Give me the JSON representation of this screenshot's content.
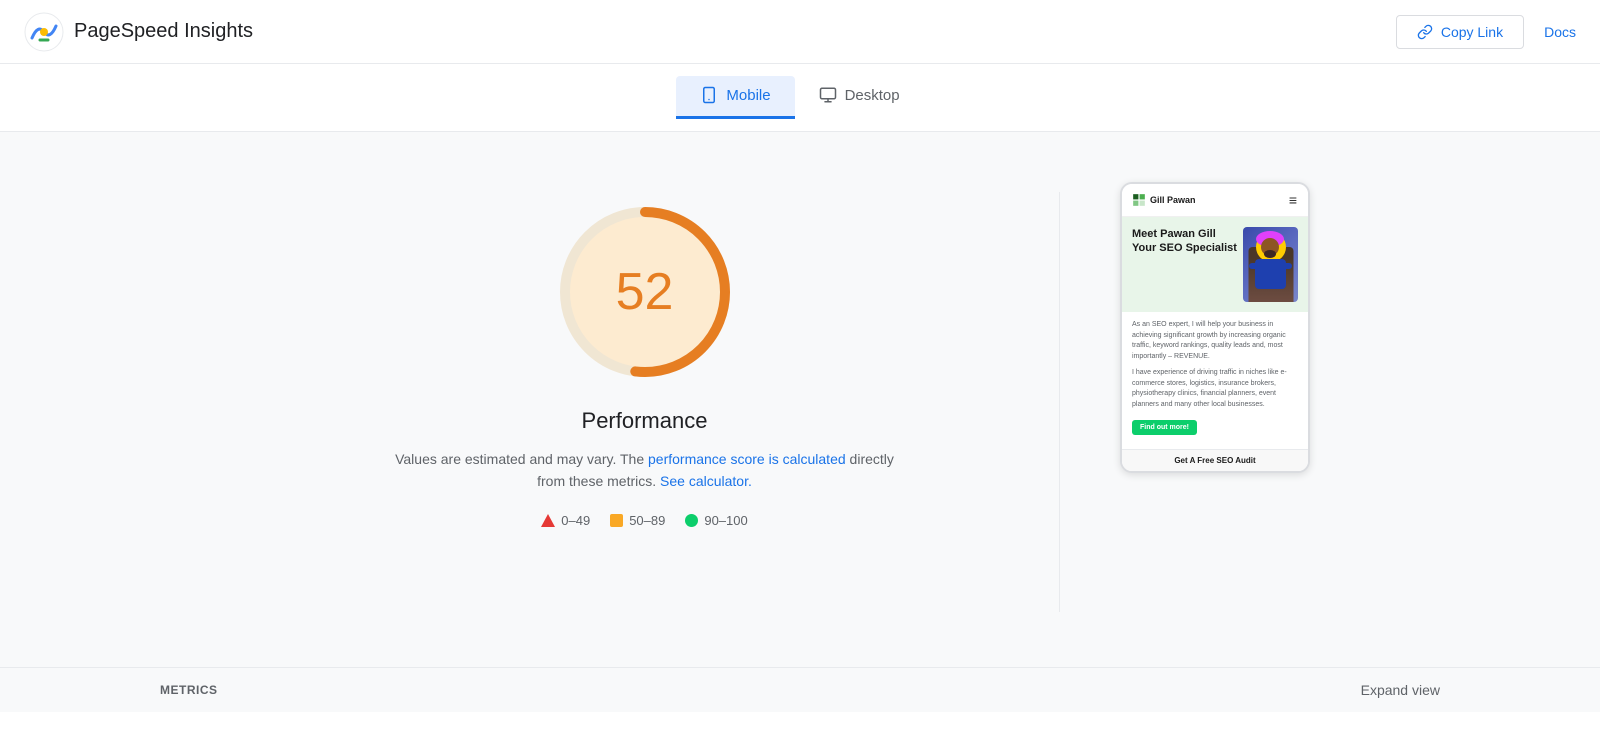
{
  "app": {
    "title": "PageSpeed Insights",
    "logo_alt": "PageSpeed Insights logo"
  },
  "header": {
    "copy_link_label": "Copy Link",
    "docs_label": "Docs"
  },
  "tabs": [
    {
      "id": "mobile",
      "label": "Mobile",
      "active": true
    },
    {
      "id": "desktop",
      "label": "Desktop",
      "active": false
    }
  ],
  "score": {
    "value": "52",
    "label": "Performance",
    "description_static": "Values are estimated and may vary. The ",
    "description_link1": "performance score is calculated",
    "description_middle": " directly from these metrics. ",
    "description_link2": "See calculator.",
    "gauge_color": "#e67e22",
    "gauge_bg_color": "#fdebd0"
  },
  "legend": [
    {
      "type": "triangle",
      "range": "0–49",
      "color": "#e53935"
    },
    {
      "type": "square",
      "range": "50–89",
      "color": "#f9a825"
    },
    {
      "type": "circle",
      "range": "90–100",
      "color": "#0cce6b"
    }
  ],
  "device_preview": {
    "site_name": "Gill Pawan",
    "hero_title": "Meet Pawan Gill Your SEO Specialist",
    "body_text1": "As an SEO expert, I will help your business in achieving significant growth by increasing organic traffic, keyword rankings, quality leads and, most importantly – REVENUE.",
    "body_text2": "I have experience of driving traffic in niches like e-commerce stores, logistics, insurance brokers, physiotherapy clinics, financial planners, event planners and many other local businesses.",
    "cta_label": "Find out more!",
    "footer_text": "Get A Free SEO Audit"
  },
  "metrics_bar": {
    "label": "METRICS",
    "expand_label": "Expand view"
  }
}
